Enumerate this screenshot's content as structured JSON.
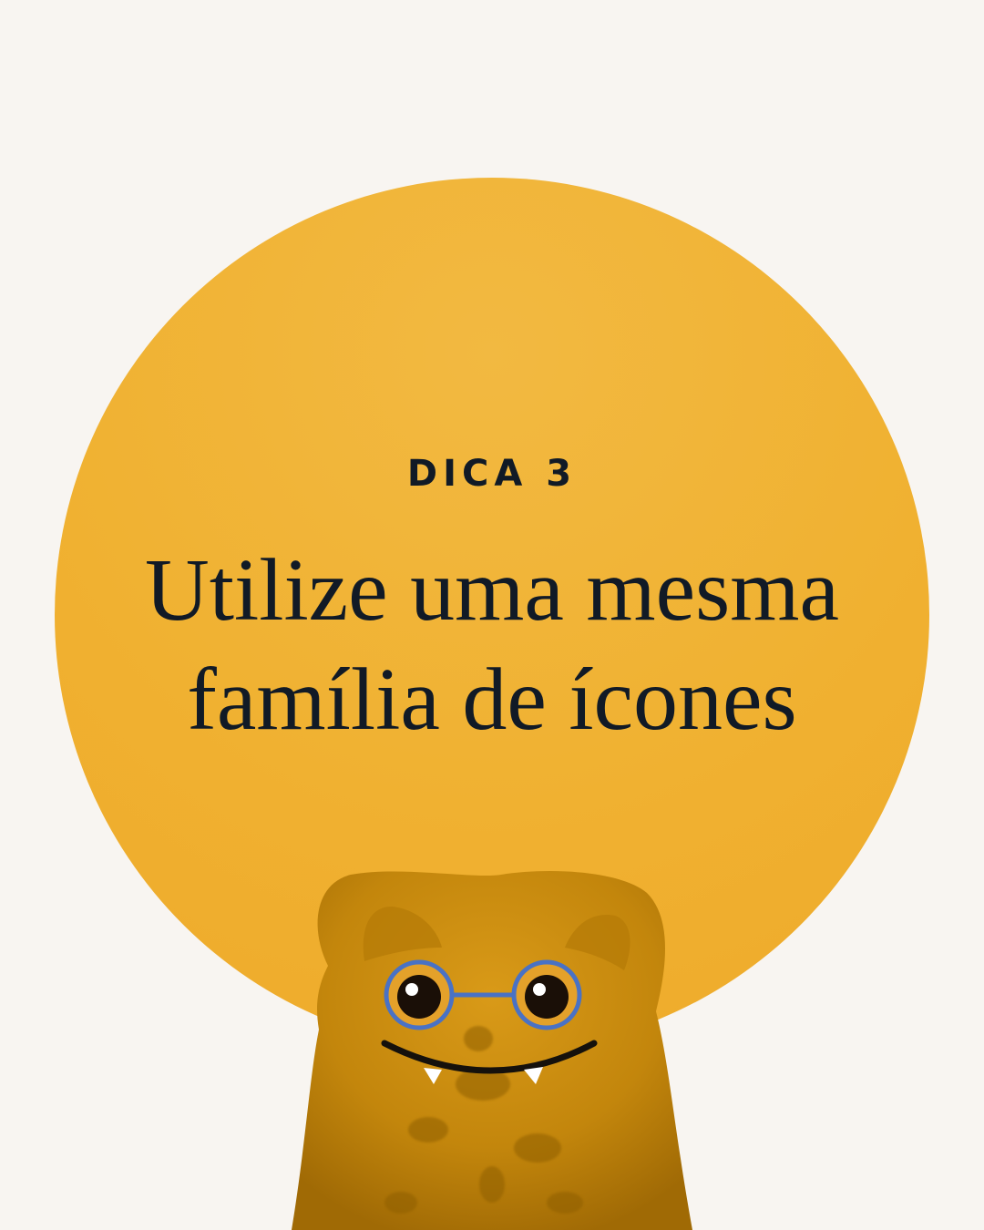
{
  "slide": {
    "label": "DICA 3",
    "headline_line1": "Utilize uma mesma",
    "headline_line2": "família de ícones"
  },
  "colors": {
    "background": "#f8f5f1",
    "circle": "#f0b131",
    "text": "#111a26",
    "gummy": "#c98a0c",
    "glasses": "#4a72c4"
  },
  "mascot": {
    "icon": "gummy-bear-with-glasses"
  }
}
